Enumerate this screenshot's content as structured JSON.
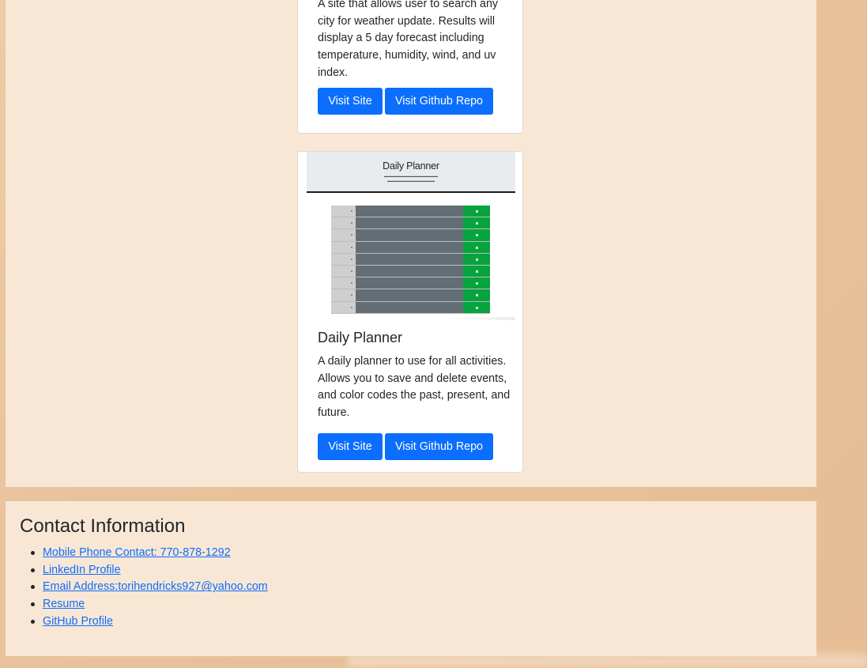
{
  "projects": [
    {
      "title": "",
      "description": "A site that allows user to search any city for weather update. Results will display a 5 day forecast including temperature, humidity, wind, and uv index.",
      "visit_label": "Visit Site",
      "repo_label": "Visit Github Repo"
    },
    {
      "title": "Daily Planner",
      "description": "A daily planner to use for all activities. Allows you to save and delete events, and color codes the past, present, and future.",
      "visit_label": "Visit Site",
      "repo_label": "Visit Github Repo",
      "thumbnail": {
        "heading": "Daily Planner",
        "rows": 9
      }
    }
  ],
  "contact": {
    "title": "Contact Information",
    "links": [
      "Mobile Phone Contact: 770-878-1292",
      "LinkedIn Profile",
      "Email Address:torihendricks927@yahoo.com",
      "Resume",
      "GitHub Profile"
    ]
  },
  "colors": {
    "background": "#eecaa6",
    "panel": "#f9e7d6",
    "button": "#0b6efd",
    "link": "#0d6efd"
  }
}
